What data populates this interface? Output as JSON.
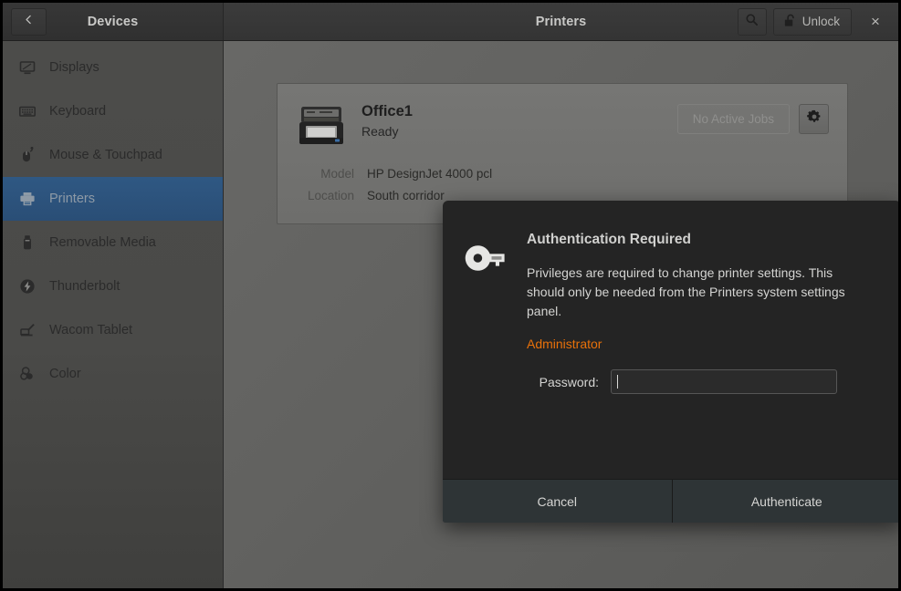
{
  "window": {
    "sidebar_header_title": "Devices",
    "main_header_title": "Printers",
    "back_icon": "chevron-left-icon",
    "search_icon": "search-icon",
    "unlock_label": "Unlock",
    "unlock_icon": "padlock-open-icon",
    "close_label": "×"
  },
  "sidebar": {
    "items": [
      {
        "label": "Displays",
        "icon": "display-icon",
        "selected": false
      },
      {
        "label": "Keyboard",
        "icon": "keyboard-icon",
        "selected": false
      },
      {
        "label": "Mouse & Touchpad",
        "icon": "mouse-icon",
        "selected": false
      },
      {
        "label": "Printers",
        "icon": "printer-icon",
        "selected": true
      },
      {
        "label": "Removable Media",
        "icon": "usb-drive-icon",
        "selected": false
      },
      {
        "label": "Thunderbolt",
        "icon": "thunderbolt-icon",
        "selected": false
      },
      {
        "label": "Wacom Tablet",
        "icon": "wacom-tablet-icon",
        "selected": false
      },
      {
        "label": "Color",
        "icon": "color-circles-icon",
        "selected": false
      }
    ]
  },
  "printer_card": {
    "icon": "printer-device-icon",
    "name": "Office1",
    "status": "Ready",
    "jobs_button": "No Active Jobs",
    "settings_icon": "gear-icon",
    "details": [
      {
        "label": "Model",
        "value": "HP DesignJet 4000 pcl"
      },
      {
        "label": "Location",
        "value": "South corridor"
      }
    ]
  },
  "dialog": {
    "icon": "key-icon",
    "title": "Authentication Required",
    "message": "Privileges are required to change printer settings. This should only be needed from the Printers system settings panel.",
    "identity": "Administrator",
    "identity_color": "#e8710a",
    "password_label": "Password:",
    "password_value": "",
    "password_placeholder": "",
    "cancel_label": "Cancel",
    "authenticate_label": "Authenticate"
  }
}
